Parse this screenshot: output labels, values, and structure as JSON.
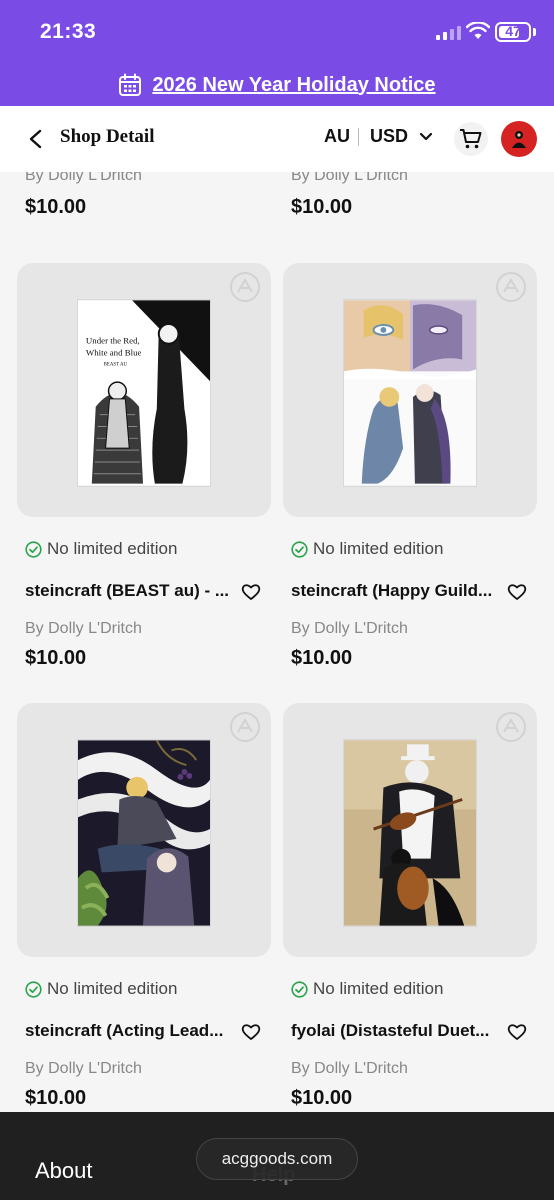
{
  "status_bar": {
    "time": "21:33",
    "battery": "47"
  },
  "notice": {
    "text": "2026 New Year Holiday Notice"
  },
  "nav": {
    "title": "Shop Detail",
    "region": "AU",
    "currency": "USD"
  },
  "previous_row": [
    {
      "author": "By Dolly L'Dritch",
      "price": "$10.00"
    },
    {
      "author": "By Dolly L'Dritch",
      "price": "$10.00"
    }
  ],
  "products": [
    {
      "badge": "No limited edition",
      "title": "steincraft (BEAST au) - ...",
      "author": "By Dolly L'Dritch",
      "price": "$10.00",
      "cover_title": "Under the Red, White and Blue",
      "cover_sub": "BEAST AU"
    },
    {
      "badge": "No limited edition",
      "title": "steincraft (Happy Guild...",
      "author": "By Dolly L'Dritch",
      "price": "$10.00"
    },
    {
      "badge": "No limited edition",
      "title": "steincraft (Acting Lead...",
      "author": "By Dolly L'Dritch",
      "price": "$10.00"
    },
    {
      "badge": "No limited edition",
      "title": "fyolai (Distasteful Duet...",
      "author": "By Dolly L'Dritch",
      "price": "$10.00"
    }
  ],
  "footer": {
    "about": "About",
    "help": "Help",
    "url": "acggoods.com"
  },
  "colors": {
    "brand": "#7b4be6",
    "check": "#2aa44a"
  }
}
